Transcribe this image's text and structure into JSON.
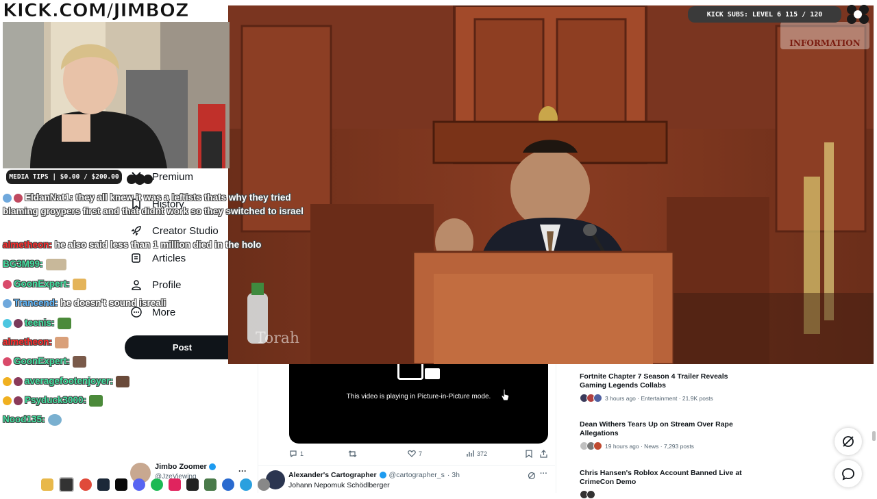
{
  "overlay": {
    "logo": "KICK.COM/JIMBOZ",
    "subs_label": "KICK SUBS: LEVEL 6 115 / 120",
    "media_tips": "MEDIA TIPS | $0.00 / $200.00",
    "subs_progress": 0.958,
    "tips_progress": 0.0
  },
  "video": {
    "watermark_top": "INFORMATION",
    "watermark_bottom": "Torah"
  },
  "chat": [
    {
      "name": "EldanNat1:",
      "color": "#ffffff",
      "message": "they all knew it was a leftists thats why they tried blaming groypers first and that didnt work so they switched to israel",
      "badge": "#6fa8dc"
    },
    {
      "name": "almetheon:",
      "color": "#ff2a2a",
      "message": "he also said less than 1 million died in the holo",
      "badge": ""
    },
    {
      "name": "BG3M99:",
      "color": "#41e0a0",
      "message": "",
      "badge": "",
      "emote": "#c8b89a"
    },
    {
      "name": "GoonExpert:",
      "color": "#41e0a0",
      "message": "",
      "badge": "#d94a6a",
      "emote": "#e4b45a"
    },
    {
      "name": "Trancend:",
      "color": "#5fb9ff",
      "message": "he doesn't sound isreali",
      "badge": "#6fa8dc"
    },
    {
      "name": "teenis:",
      "color": "#41e0a0",
      "message": "",
      "badge": "#4dc6e0",
      "emote": "#4b8a3a"
    },
    {
      "name": "almetheon:",
      "color": "#ff2a2a",
      "message": "",
      "badge": "",
      "emote": "#d9a07a"
    },
    {
      "name": "GoonExpert:",
      "color": "#41e0a0",
      "message": "",
      "badge": "#d94a6a",
      "emote": "#7a5a4a"
    },
    {
      "name": "averagefootenjoyer:",
      "color": "#41e0a0",
      "message": "",
      "badge": "#f0b020",
      "emote": "#6a4a3a"
    },
    {
      "name": "Psyduck3000:",
      "color": "#41e0a0",
      "message": "",
      "badge": "#f0b020",
      "emote": "#4b8a3a"
    },
    {
      "name": "Nood135:",
      "color": "#41e0a0",
      "message": "",
      "badge": "",
      "emote": "#7ab0d0"
    }
  ],
  "x_sidebar": {
    "items": [
      {
        "label": "Premium",
        "icon": "x-logo-icon"
      },
      {
        "label": "History",
        "icon": "bookmark-icon"
      },
      {
        "label": "Creator Studio",
        "icon": "rocket-icon"
      },
      {
        "label": "Articles",
        "icon": "article-icon"
      },
      {
        "label": "Profile",
        "icon": "person-icon"
      },
      {
        "label": "More",
        "icon": "more-circle-icon"
      }
    ],
    "post_button": "Post",
    "account_name": "Jimbo Zoomer",
    "account_handle": "@JzeViewing",
    "account_more": "···"
  },
  "tweet": {
    "pip_message": "This video is playing in Picture-in-Picture mode.",
    "replies": "1",
    "likes": "7",
    "views": "372"
  },
  "next_tweet": {
    "author": "Alexander's Cartographer",
    "handle": "@cartographer_s",
    "time": "· 3h",
    "text": "Johann Nepomuk Schödlberger",
    "more": "···"
  },
  "trends": [
    {
      "title": "Fortnite Chapter 7 Season 4 Trailer Reveals Gaming Legends Collabs",
      "meta": "3 hours ago · Entertainment · 21.9K posts"
    },
    {
      "title": "Dean Withers Tears Up on Stream Over Rape Allegations",
      "meta": "19 hours ago · News · 7,293 posts"
    },
    {
      "title": "Chris Hansen's Roblox Account Banned Live at CrimeCon Demo",
      "meta": ""
    }
  ]
}
